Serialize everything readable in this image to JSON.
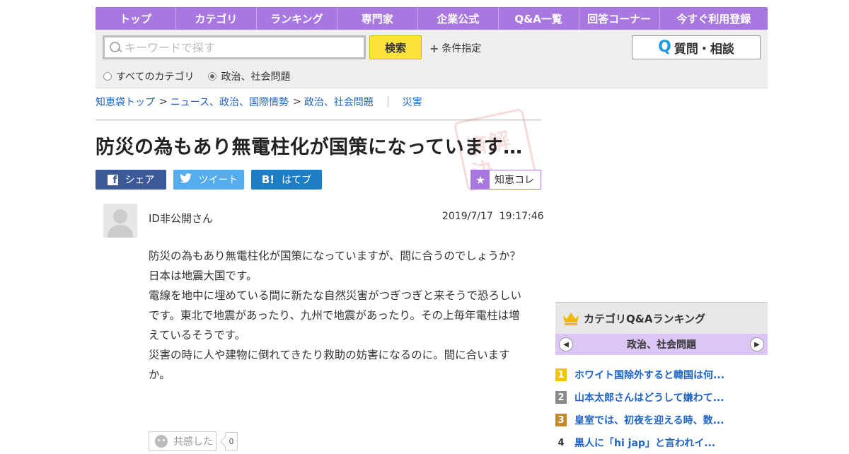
{
  "nav": [
    "トップ",
    "カテゴリ",
    "ランキング",
    "専門家",
    "企業公式",
    "Q&A一覧",
    "回答コーナー",
    "今すぐ利用登録"
  ],
  "search": {
    "placeholder": "キーワードで探す",
    "button": "検索",
    "conditions": "条件指定",
    "ask_button": "質問・相談",
    "radios": [
      {
        "label": "すべてのカテゴリ",
        "selected": false
      },
      {
        "label": "政治、社会問題",
        "selected": true
      }
    ]
  },
  "breadcrumb": {
    "items": [
      "知恵袋トップ",
      "ニュース、政治、国際情勢",
      "政治、社会問題"
    ],
    "separator": ">",
    "tag": "災害"
  },
  "question": {
    "title": "防災の為もあり無電柱化が国策になっています…",
    "stamp": "済解決",
    "share": {
      "facebook": "シェア",
      "twitter": "ツイート",
      "hatena": "はてブ"
    },
    "chiekore": "知恵コレ",
    "user": "ID非公開さん",
    "date": "2019/7/17",
    "time": "19:17:46",
    "body": [
      "防災の為もあり無電柱化が国策になっていますが、間に合うのでしょうか？",
      "日本は地震大国です。",
      "電線を地中に埋めている間に新たな自然災害がつぎつぎと来そうで恐ろしいです。東北で地震があったり、九州で地震があったり。その上毎年電柱は増えているそうです。",
      "災害の時に人や建物に倒れてきたり救助の妨害になるのに。間に合いますか。"
    ],
    "kyokan_label": "共感した",
    "kyokan_count": "0"
  },
  "ranking": {
    "heading": "カテゴリQ&Aランキング",
    "category": "政治、社会問題",
    "items": [
      {
        "rank": "1",
        "text": "ホワイト国除外すると韓国は何..."
      },
      {
        "rank": "2",
        "text": "山本太郎さんはどうして嫌わて..."
      },
      {
        "rank": "3",
        "text": "皇室では、初夜を迎える時、数..."
      },
      {
        "rank": "4",
        "text": "黒人に「hi jap」と言われイ..."
      }
    ]
  },
  "colors": {
    "nav": "#a877e0",
    "search_button": "#ffe33d",
    "link": "#1d64c6",
    "facebook": "#3b5998",
    "twitter": "#55acee",
    "hatena": "#1d7ec4"
  }
}
